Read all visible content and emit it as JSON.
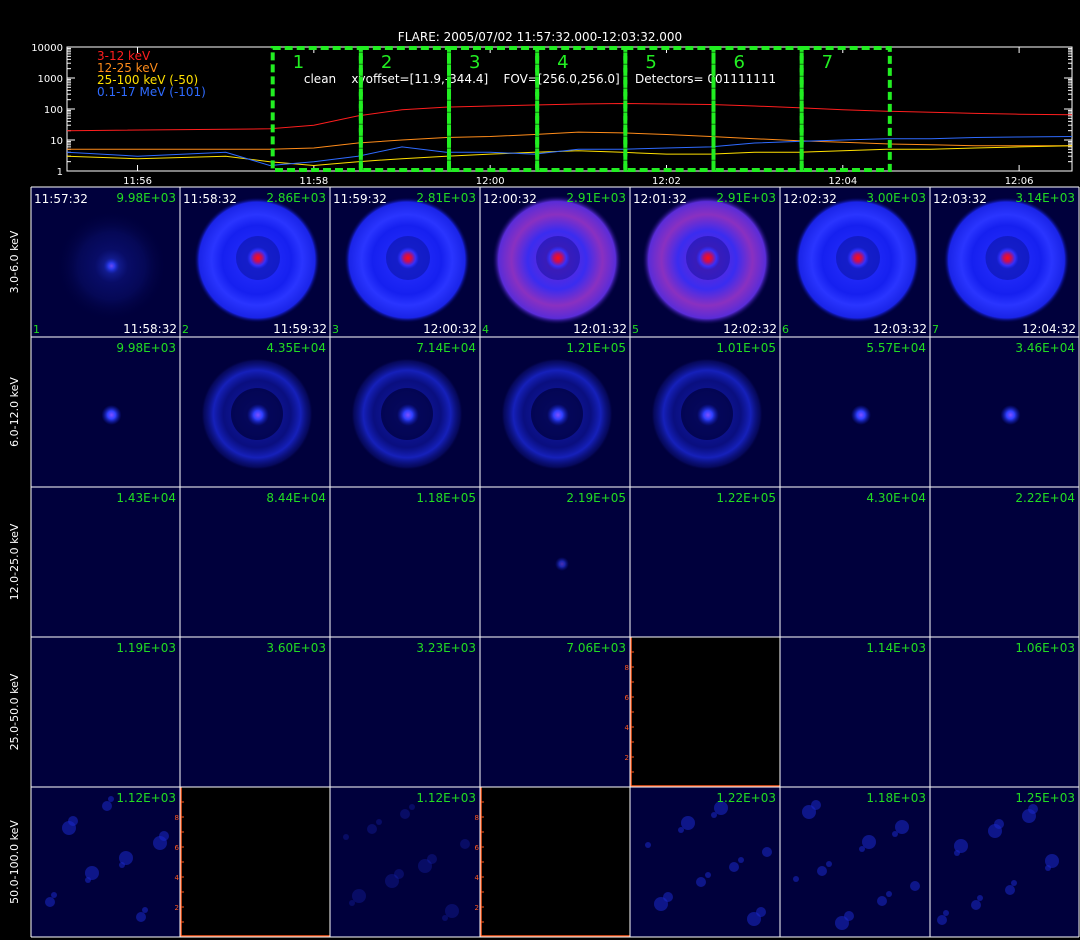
{
  "header": {
    "title": "FLARE: 2005/07/02 11:57:32.000-12:03:32.000",
    "subtitle": "clean    xyoffset=[11.9,-344.4]    FOV=[256.0,256.0]    Detectors= 001111111"
  },
  "colors": {
    "curve_3_12": "#ff1e1e",
    "curve_12_25": "#ff8c1a",
    "curve_25_100": "#ffe000",
    "curve_01_17": "#2f6bff",
    "window_box": "#22ee22",
    "number_text": "#22dd22",
    "tile_bg": "#00003c",
    "tile_blue": "#1a28ff",
    "core_red": "#ff1010"
  },
  "chart_data": [
    {
      "type": "line",
      "yscale": "log",
      "ylim": [
        1,
        10000
      ],
      "y_ticks": [
        "1",
        "10",
        "100",
        "1000",
        "10000"
      ],
      "x_ticks": [
        "11:56",
        "11:58",
        "12:00",
        "12:02",
        "12:04",
        "12:06"
      ],
      "xlim": [
        "11:55:12",
        "12:06:36"
      ],
      "series": [
        {
          "name": "3-12 keV",
          "x": [
            "11:55:12",
            "11:57:30",
            "11:58:00",
            "11:58:30",
            "11:59:00",
            "11:59:30",
            "12:00:00",
            "12:00:30",
            "12:01:00",
            "12:01:30",
            "12:02:00",
            "12:02:30",
            "12:03:00",
            "12:03:30",
            "12:04:00",
            "12:04:30",
            "12:05:00",
            "12:05:30",
            "12:06:00",
            "12:06:36"
          ],
          "y": [
            20,
            23,
            30,
            60,
            95,
            115,
            125,
            135,
            145,
            150,
            145,
            140,
            125,
            110,
            95,
            85,
            78,
            72,
            68,
            65
          ]
        },
        {
          "name": "12-25 keV",
          "x": [
            "11:55:12",
            "11:57:30",
            "11:58:00",
            "11:58:30",
            "11:59:00",
            "11:59:30",
            "12:00:00",
            "12:00:30",
            "12:01:00",
            "12:01:30",
            "12:02:00",
            "12:02:30",
            "12:03:00",
            "12:03:30",
            "12:04:00",
            "12:04:30",
            "12:05:00",
            "12:05:30",
            "12:06:00",
            "12:06:36"
          ],
          "y": [
            5,
            5,
            5.5,
            8,
            10,
            12,
            13,
            15,
            18,
            17,
            15,
            13,
            11,
            9.5,
            8.5,
            7.5,
            7,
            6.5,
            6.5,
            6.5
          ]
        },
        {
          "name": "25-100 keV (-50)",
          "x": [
            "11:55:12",
            "11:56:00",
            "11:57:00",
            "11:57:30",
            "11:58:00",
            "11:58:30",
            "11:59:00",
            "11:59:30",
            "12:00:00",
            "12:00:30",
            "12:01:00",
            "12:01:30",
            "12:02:00",
            "12:02:30",
            "12:03:00",
            "12:03:30",
            "12:04:00",
            "12:04:30",
            "12:05:00",
            "12:05:30",
            "12:06:00",
            "12:06:36"
          ],
          "y": [
            3,
            2.5,
            3,
            2,
            1.5,
            2,
            2.5,
            3,
            3.5,
            4,
            4.5,
            4,
            3.5,
            3.5,
            4,
            4,
            4.5,
            5,
            5,
            5.5,
            6,
            6.5
          ]
        },
        {
          "name": "0.1-17 MeV (-101)",
          "x": [
            "11:55:12",
            "11:56:00",
            "11:57:00",
            "11:57:30",
            "11:58:00",
            "11:58:30",
            "11:59:00",
            "11:59:30",
            "12:00:00",
            "12:00:30",
            "12:01:00",
            "12:01:30",
            "12:02:00",
            "12:02:30",
            "12:03:00",
            "12:03:30",
            "12:04:00",
            "12:04:30",
            "12:05:00",
            "12:05:30",
            "12:06:00",
            "12:06:36"
          ],
          "y": [
            4,
            3,
            4,
            1.5,
            2,
            3,
            6,
            4,
            4,
            3.5,
            5,
            5,
            5.5,
            6,
            8,
            9,
            10,
            11,
            11,
            12,
            12.5,
            13
          ]
        }
      ],
      "windows": [
        {
          "label": "1",
          "start": "11:57:32",
          "end": "11:58:32"
        },
        {
          "label": "2",
          "start": "11:58:32",
          "end": "11:59:32"
        },
        {
          "label": "3",
          "start": "11:59:32",
          "end": "12:00:32"
        },
        {
          "label": "4",
          "start": "12:00:32",
          "end": "12:01:32"
        },
        {
          "label": "5",
          "start": "12:01:32",
          "end": "12:02:32"
        },
        {
          "label": "6",
          "start": "12:02:32",
          "end": "12:03:32"
        },
        {
          "label": "7",
          "start": "12:03:32",
          "end": "12:04:32"
        }
      ]
    },
    {
      "type": "heatmap",
      "energy_bands": [
        "3.0-6.0 keV",
        "6.0-12.0 keV",
        "12.0-25.0 keV",
        "25.0-50.0 keV",
        "50.0-100.0 keV"
      ],
      "time_starts": [
        "11:57:32",
        "11:58:32",
        "11:59:32",
        "12:00:32",
        "12:01:32",
        "12:02:32",
        "12:03:32"
      ],
      "time_ends": [
        "11:58:32",
        "11:59:32",
        "12:00:32",
        "12:01:32",
        "12:02:32",
        "12:03:32",
        "12:04:32"
      ],
      "panel_numbers": [
        "1",
        "2",
        "3",
        "4",
        "5",
        "6",
        "7"
      ],
      "peak_values": [
        [
          "9.98E+03",
          "2.86E+03",
          "2.81E+03",
          "2.91E+03",
          "2.91E+03",
          "3.00E+03",
          "3.14E+03"
        ],
        [
          "9.98E+03",
          "4.35E+04",
          "7.14E+04",
          "1.21E+05",
          "1.01E+05",
          "5.57E+04",
          "3.46E+04"
        ],
        [
          "1.43E+04",
          "8.44E+04",
          "1.18E+05",
          "2.19E+05",
          "1.22E+05",
          "4.30E+04",
          "2.22E+04"
        ],
        [
          "1.19E+03",
          "3.60E+03",
          "3.23E+03",
          "7.06E+03",
          "",
          "1.14E+03",
          "1.06E+03"
        ],
        [
          "1.12E+03",
          "",
          "1.12E+03",
          "",
          "1.22E+03",
          "1.18E+03",
          "1.25E+03"
        ]
      ],
      "image_kind": [
        [
          "faint",
          "ring",
          "ring",
          "ring-red",
          "ring-red",
          "ring",
          "ring"
        ],
        [
          "dot",
          "ring-faint",
          "ring-faint",
          "ring-faint",
          "ring-faint",
          "dot",
          "dot"
        ],
        [
          "empty",
          "empty",
          "empty",
          "dot-faint",
          "empty",
          "empty",
          "empty"
        ],
        [
          "empty",
          "empty",
          "empty",
          "empty",
          "blank-axes",
          "empty",
          "empty"
        ],
        [
          "speckle",
          "blank-axes",
          "speckle-faint",
          "blank-axes",
          "speckle",
          "speckle",
          "speckle"
        ]
      ],
      "blank_axis_ticks": [
        "2",
        "4",
        "6",
        "8"
      ]
    }
  ]
}
